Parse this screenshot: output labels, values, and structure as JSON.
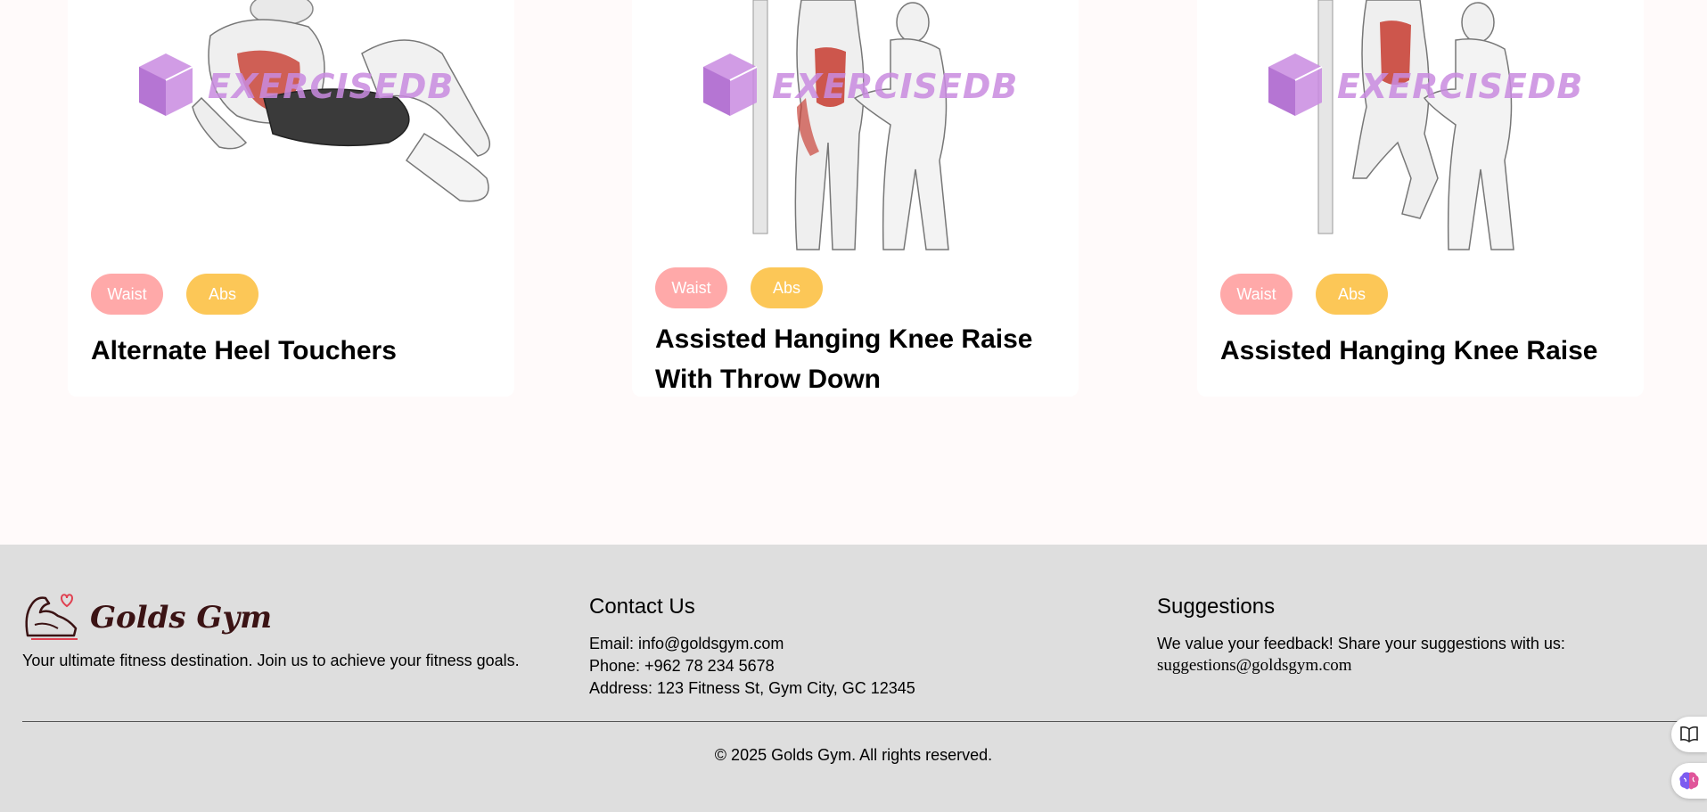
{
  "cards": [
    {
      "tags": [
        "Waist",
        "Abs"
      ],
      "title": "Alternate Heel Touchers",
      "watermark": "EXERCISEDB",
      "image_icon": "exercise-illustration"
    },
    {
      "tags": [
        "Waist",
        "Abs"
      ],
      "title": "Assisted Hanging Knee Raise With Throw Down",
      "watermark": "EXERCISEDB",
      "image_icon": "exercise-illustration"
    },
    {
      "tags": [
        "Waist",
        "Abs"
      ],
      "title": "Assisted Hanging Knee Raise",
      "watermark": "EXERCISEDB",
      "image_icon": "exercise-illustration"
    }
  ],
  "footer": {
    "brand": "Golds Gym",
    "logo_icon": "flexed-arm-heart-icon",
    "tagline": "Your ultimate fitness destination. Join us to achieve your fitness goals.",
    "contact": {
      "heading": "Contact Us",
      "email": "Email: info@goldsgym.com",
      "phone": "Phone: +962 78 234 5678",
      "address": "Address: 123 Fitness St, Gym City, GC 12345"
    },
    "suggestions": {
      "heading": "Suggestions",
      "text": "We value your feedback! Share your suggestions with us:",
      "email": "suggestions@goldsgym.com"
    },
    "copyright": "© 2025 Golds Gym. All rights reserved."
  },
  "floating_buttons": [
    "book-icon",
    "brain-icon"
  ],
  "colors": {
    "page_bg": "#fffafa",
    "waist_tag": "#ffa9a9",
    "abs_tag": "#fcc757",
    "footer_bg": "#dedede",
    "brand_text": "#3b1314",
    "watermark": "#c98be0"
  }
}
